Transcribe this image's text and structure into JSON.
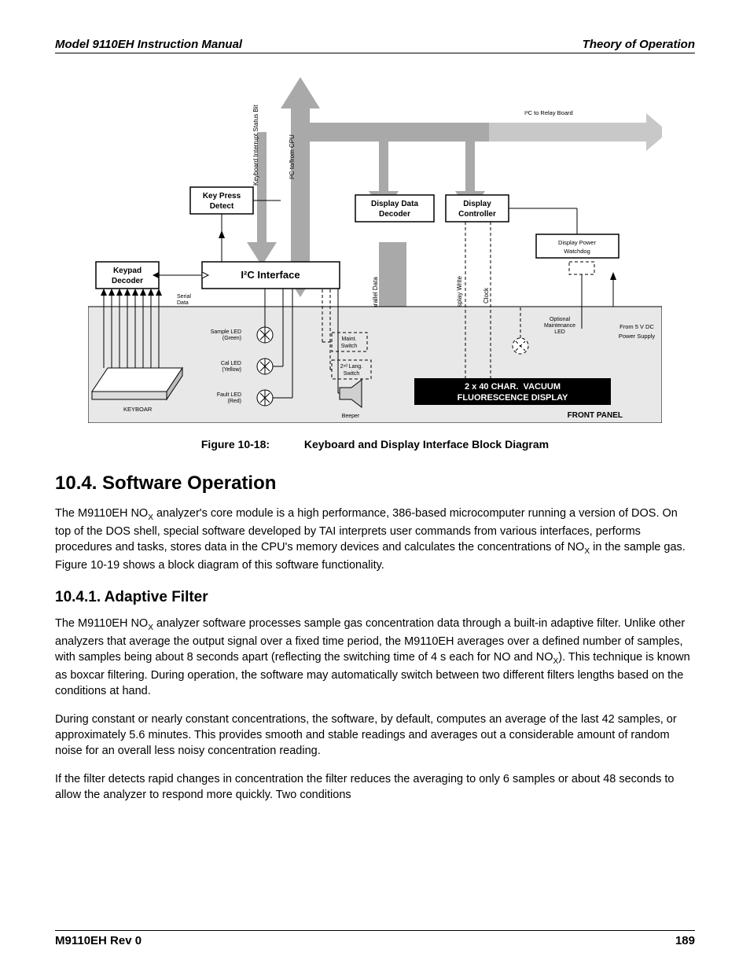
{
  "header": {
    "left": "Model 9110EH Instruction Manual",
    "right": "Theory of Operation"
  },
  "diagram": {
    "top_right": "I²C to Relay Board",
    "key_press": "Key Press\nDetect",
    "kbd_int": "Keyboard Interrupt Status Bit",
    "i2c_cpu": "I²C to/from CPU",
    "disp_data": "Display Data\nDecoder",
    "disp_ctrl": "Display\nController",
    "disp_pw": "Display Power\nWatchdog",
    "keypad": "Keypad\nDecoder",
    "i2c_if": "I²C Interface",
    "serial": "Serial\nData",
    "par_data": "Parallel Data",
    "disp_write": "Display Write",
    "clock": "Clock",
    "opt_maint": "Optional\nMaintenance\nLED",
    "from5v": "From 5 V DC\nPower Supply",
    "sample_led": "Sample LED\n(Green)",
    "cal_led": "Cal LED\n(Yellow)",
    "fault_led": "Fault LED\n(Red)",
    "maint_sw": "Maint.\nSwitch",
    "lang_sw": "2ⁿᵈ Lang.\nSwitch",
    "beeper": "Beeper",
    "vfd": "2 x 40 CHAR.  VACUUM\nFLUORESCENCE DISPLAY",
    "front": "FRONT PANEL",
    "keyboar": "KEYBOAR"
  },
  "figure": {
    "label": "Figure 10-18:",
    "title": "Keyboard and Display Interface Block Diagram"
  },
  "h2": "10.4. Software Operation",
  "p1a": "The M9110EH NO",
  "p1b": " analyzer's core module is a high performance, 386-based microcomputer running a version of DOS. On top of the DOS shell, special software developed by TAI interprets user commands from various interfaces, performs procedures and tasks, stores data in the CPU's memory devices and calculates the concentrations of NO",
  "p1c": " in the sample gas. Figure 10-19 shows a block diagram of this software functionality.",
  "h3": "10.4.1. Adaptive Filter",
  "p2a": "The M9110EH NO",
  "p2b": " analyzer software processes sample gas concentration data through a built-in adaptive filter. Unlike other analyzers that average the output signal over a fixed time period, the M9110EH averages over a defined number of samples, with samples being about 8 seconds apart (reflecting the switching time of 4 s each for NO and NO",
  "p2c": "). This technique is known as boxcar filtering. During operation, the software may automatically switch between two different filters lengths based on the conditions at hand.",
  "p3": "During constant or nearly constant concentrations, the software, by default, computes an average of the last 42 samples, or approximately 5.6 minutes. This provides smooth and stable readings and averages out a considerable amount of random noise for an overall less noisy concentration reading.",
  "p4": "If the filter detects rapid changes in concentration the filter reduces the averaging to only 6 samples or about 48 seconds to allow the analyzer to respond more quickly. Two conditions",
  "footer": {
    "left": "M9110EH Rev 0",
    "right": "189"
  },
  "subx": "X"
}
